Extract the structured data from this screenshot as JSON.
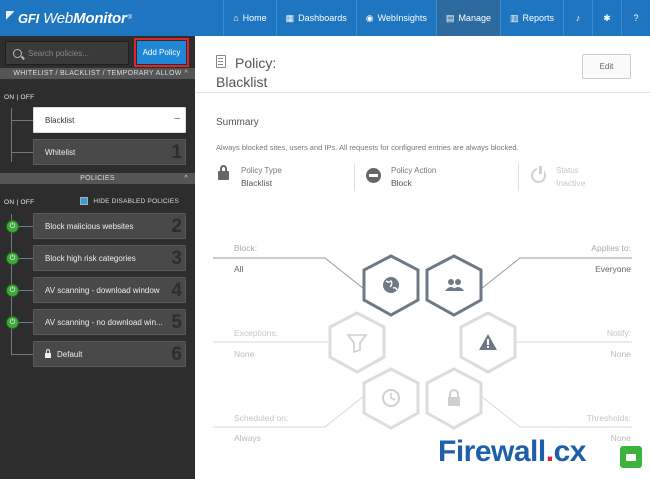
{
  "brand": {
    "gfi": "GFI",
    "name_a": "Web",
    "name_b": "Monitor",
    "tm": "®"
  },
  "nav": [
    {
      "icon": "home-icon",
      "glyph": "⌂",
      "label": "Home",
      "active": false
    },
    {
      "icon": "chart-icon",
      "glyph": "▦",
      "label": "Dashboards",
      "active": false
    },
    {
      "icon": "eye-icon",
      "glyph": "◉",
      "label": "WebInsights",
      "active": false
    },
    {
      "icon": "document-icon",
      "glyph": "▤",
      "label": "Manage",
      "active": true
    },
    {
      "icon": "bar-chart-icon",
      "glyph": "▥",
      "label": "Reports",
      "active": false
    },
    {
      "icon": "bell-icon",
      "glyph": "♪",
      "label": "",
      "active": false
    },
    {
      "icon": "gear-icon",
      "glyph": "✱",
      "label": "",
      "active": false
    },
    {
      "icon": "help-icon",
      "glyph": "?",
      "label": "",
      "active": false
    }
  ],
  "sidebar": {
    "search_placeholder": "Search policies...",
    "add_policy": "Add Policy",
    "section1": "WHITELIST / BLACKLIST / TEMPORARY ALLOW",
    "onoff1": "ON | OFF",
    "lists": [
      {
        "label": "Blacklist",
        "num": "–",
        "selected": true
      },
      {
        "label": "Whitelist",
        "num": "1",
        "selected": false
      }
    ],
    "section2": "POLICIES",
    "onoff2": "ON | OFF",
    "hide_disabled": "HIDE DISABLED POLICIES",
    "policies": [
      {
        "label": "Block malicious websites",
        "num": "2",
        "power": true
      },
      {
        "label": "Block high risk categories",
        "num": "3",
        "power": true
      },
      {
        "label": "AV scanning - download window",
        "num": "4",
        "power": true
      },
      {
        "label": "AV scanning - no download win...",
        "num": "5",
        "power": true
      },
      {
        "label": "Default",
        "num": "6",
        "power": false,
        "lock": true
      }
    ]
  },
  "main": {
    "title": "Policy:",
    "name": "Blacklist",
    "edit": "Edit",
    "summary_heading": "Summary",
    "summary_text": "Always blocked sites, users and IPs. All requests for configured entries are always blocked.",
    "attributes": [
      {
        "label": "Policy Type",
        "value": "Blacklist",
        "icon": "lock-icon"
      },
      {
        "label": "Policy Action",
        "value": "Block",
        "icon": "minus-circle-icon"
      },
      {
        "label": "Status",
        "value": "Inactive",
        "icon": "power-icon"
      }
    ],
    "diagram": {
      "block_label": "Block:",
      "block_value": "All",
      "applies_label": "Applies to:",
      "applies_value": "Everyone",
      "exceptions_label": "Exceptions:",
      "exceptions_value": "None",
      "notify_label": "Notify:",
      "notify_value": "None",
      "scheduled_label": "Scheduled on:",
      "scheduled_value": "Always",
      "thresholds_label": "Thresholds:",
      "thresholds_value": "None"
    }
  },
  "watermark": {
    "main": "Firewall",
    "dot": ".",
    "tld": "cx"
  }
}
